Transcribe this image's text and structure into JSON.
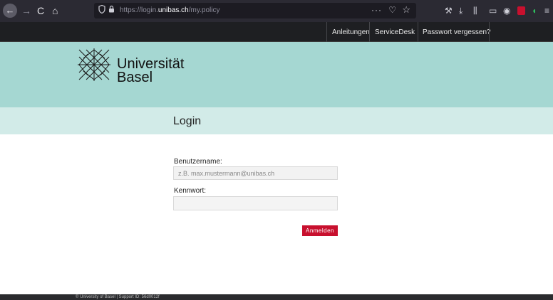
{
  "browser": {
    "back_icon": "←",
    "forward_icon": "→",
    "reload_icon": "C",
    "home_icon": "⌂",
    "url_prefix": "https://login.",
    "url_host": "unibas.ch",
    "url_path": "/my.policy",
    "more_icon": "···",
    "pocket_icon": "♡",
    "star_icon": "☆",
    "toolbar_icons": {
      "tools": "⚒",
      "download": "⤓",
      "library": "⫼",
      "sidebar": "▭",
      "account": "◉",
      "green": "◖",
      "menu": "≡"
    }
  },
  "topnav": {
    "links": [
      "Anleitungen",
      "ServiceDesk",
      "Passwort vergessen?"
    ]
  },
  "brand": {
    "line1": "Universität",
    "line2": "Basel"
  },
  "login": {
    "title": "Login",
    "username_label": "Benutzername:",
    "username_placeholder": "z.B. max.mustermann@unibas.ch",
    "password_label": "Kennwort:",
    "password_value": "",
    "submit_label": "Anmelden"
  },
  "footer": {
    "text": "© University of Basel | Support ID: 56d0012f"
  },
  "colors": {
    "header_bg": "#a5d7d2",
    "band_bg": "#d2ebe8",
    "accent": "#c8102e",
    "topnav_bg": "#1e1f22"
  }
}
